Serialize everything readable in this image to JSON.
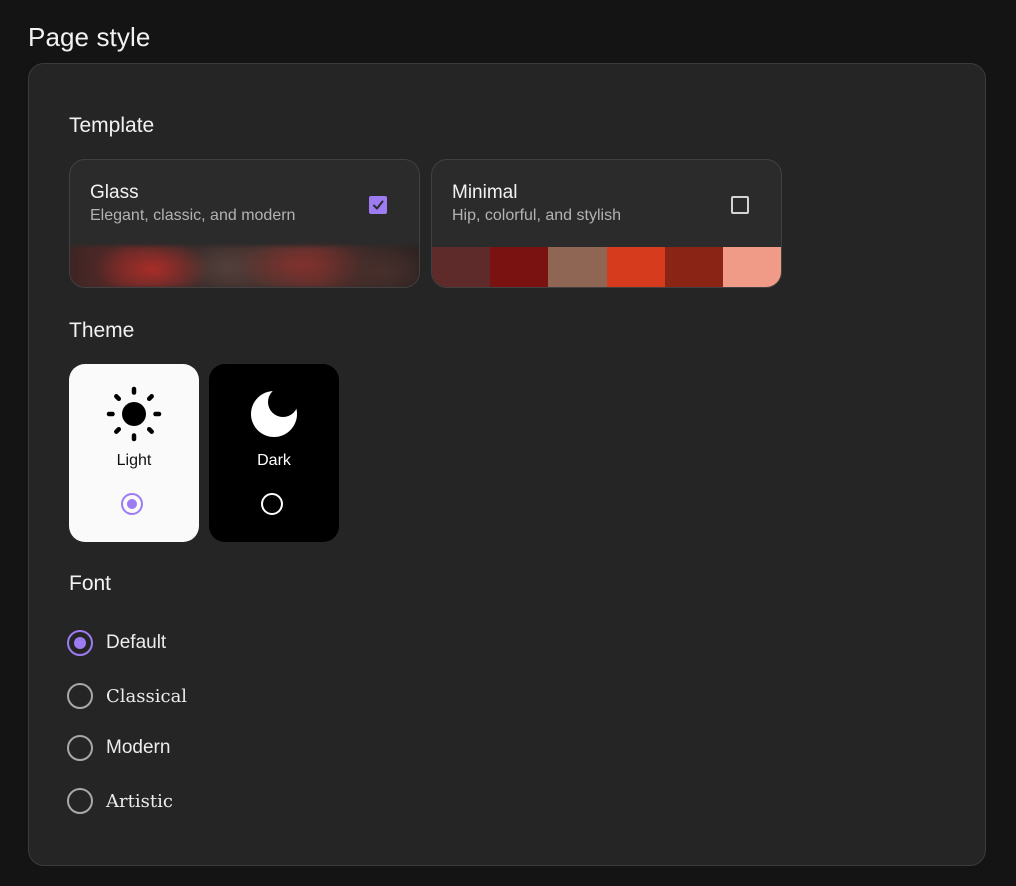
{
  "page": {
    "title": "Page style"
  },
  "template": {
    "heading": "Template",
    "options": [
      {
        "name": "Glass",
        "description": "Elegant, classic, and modern",
        "selected": true
      },
      {
        "name": "Minimal",
        "description": "Hip, colorful, and stylish",
        "selected": false,
        "palette": [
          "#5e2a2a",
          "#7a1212",
          "#8f6654",
          "#d63b1e",
          "#8a2516",
          "#f09b88"
        ]
      }
    ]
  },
  "theme": {
    "heading": "Theme",
    "options": [
      {
        "label": "Light",
        "icon": "sun-icon",
        "selected": true
      },
      {
        "label": "Dark",
        "icon": "moon-icon",
        "selected": false
      }
    ]
  },
  "font": {
    "heading": "Font",
    "options": [
      {
        "label": "Default",
        "selected": true
      },
      {
        "label": "Classical",
        "selected": false
      },
      {
        "label": "Modern",
        "selected": false
      },
      {
        "label": "Artistic",
        "selected": false
      }
    ]
  },
  "colors": {
    "accent": "#9c7cf0",
    "panel": "#252525",
    "background": "#141414"
  }
}
